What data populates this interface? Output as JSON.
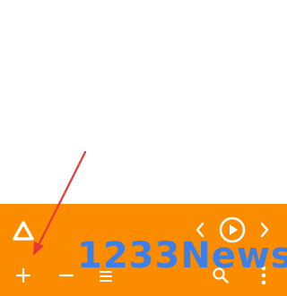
{
  "toolbar": {
    "color": "#fb8c00",
    "icon_color": "#ffffff",
    "top_row": [
      {
        "icon": "app-logo-icon"
      },
      {
        "icon": "chevron-left-icon"
      },
      {
        "icon": "play-circle-icon"
      },
      {
        "icon": "chevron-right-icon"
      }
    ],
    "bottom_row": [
      {
        "icon": "plus-icon"
      },
      {
        "icon": "minus-icon"
      },
      {
        "icon": "menu-lines-icon"
      },
      {
        "icon": "search-icon"
      },
      {
        "icon": "more-vertical-icon"
      }
    ]
  },
  "watermark": {
    "text": "1233News",
    "color": "#3d7fe6"
  },
  "annotation": {
    "arrow_color": "#e53935",
    "target": "plus-icon"
  }
}
